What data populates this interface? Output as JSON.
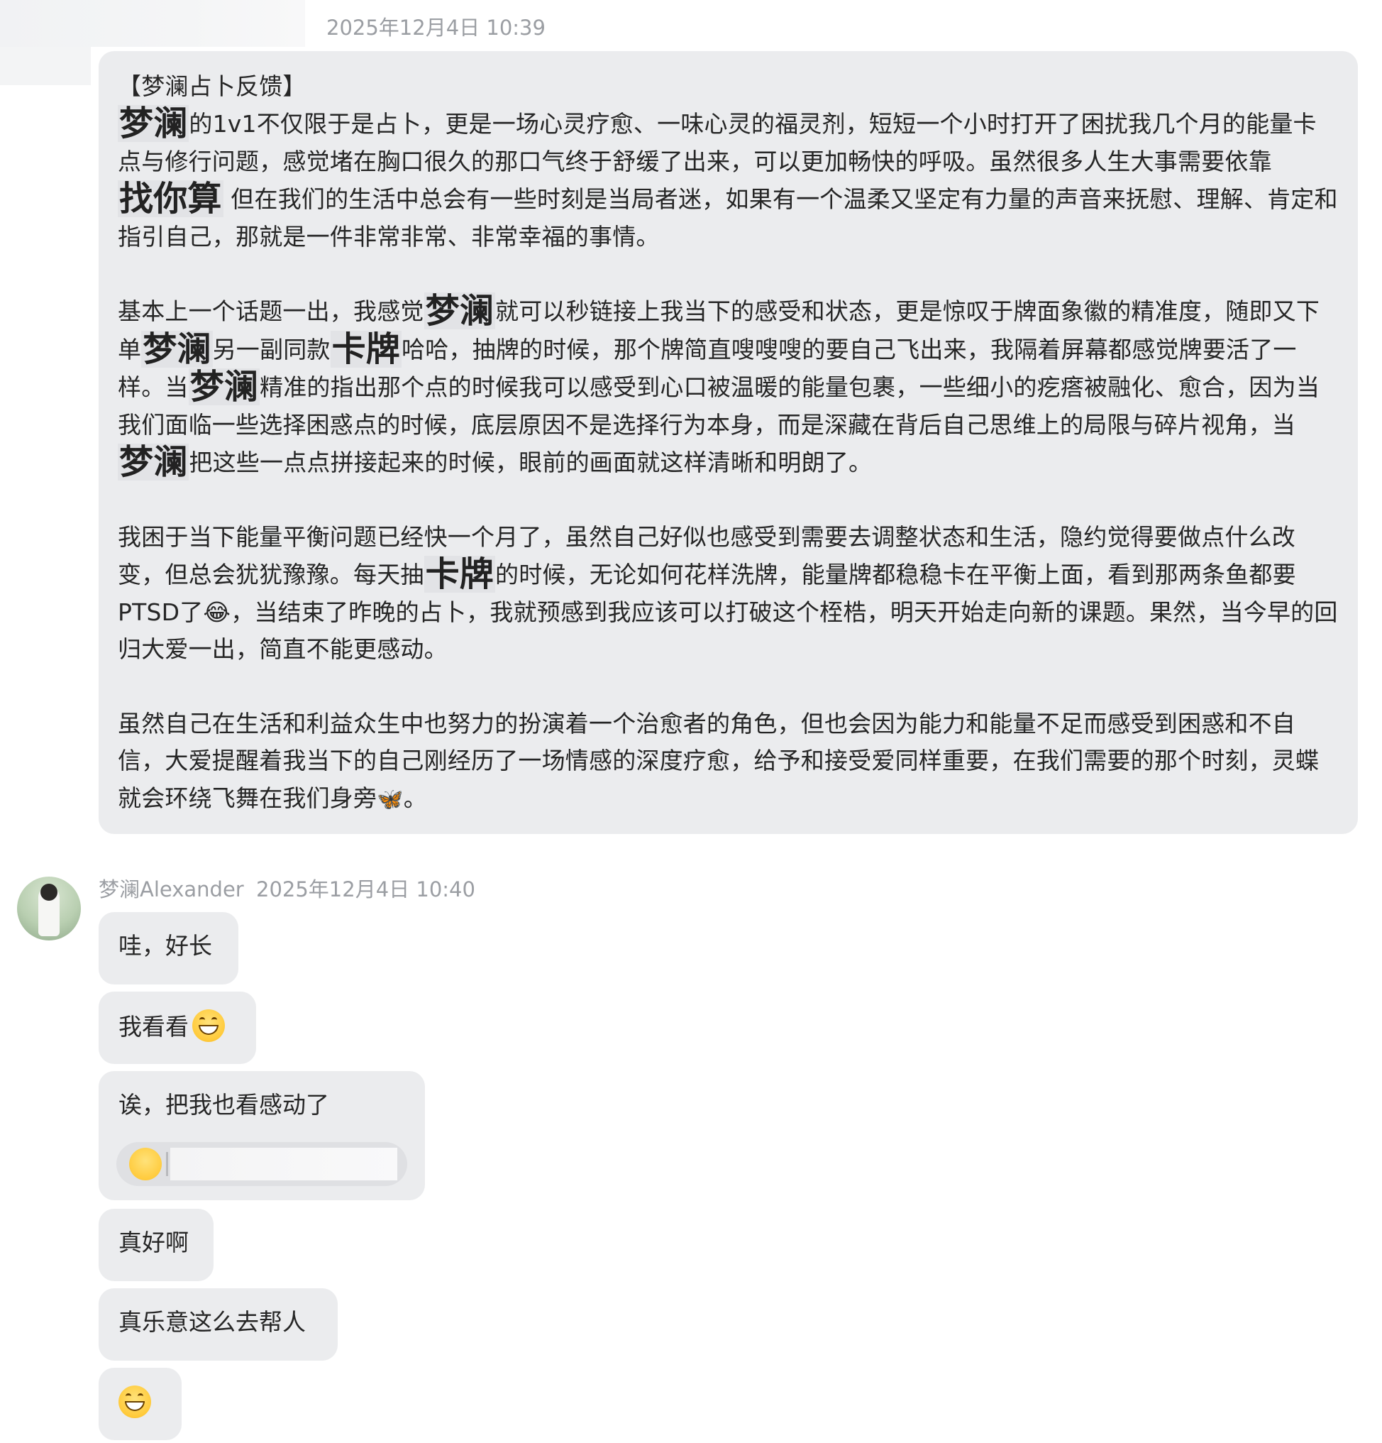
{
  "header": {
    "timestamp": "2025年12月4日 10:39"
  },
  "long_message": {
    "paragraphs": [
      {
        "segments": [
          {
            "t": "【梦澜占卜反馈】",
            "br": true
          },
          {
            "t": "梦澜",
            "ovl": true
          },
          {
            "t": "的1v1不仅限于是占卜，更是一场心灵疗愈、一味心灵的福灵剂，短短一个小时打开了困扰我几个月的能量卡点与修行问题，感觉堵在胸口很久的那口气终于舒缓了出来，可以更加畅快的呼吸。虽然很多人生大事需要依靠"
          },
          {
            "t": "找你算",
            "ovl": true
          },
          {
            "t": " 但在我们的生活中总会有一些时刻是当局者迷，如果有一个温柔又坚定有力量的声音来抚慰、理解、肯定和指引自己，那就是一件非常非常、非常幸福的事情。"
          }
        ]
      },
      {
        "segments": [
          {
            "t": "基本上一个话题一出，我感觉"
          },
          {
            "t": "梦澜",
            "ovl": true
          },
          {
            "t": "就可以秒链接上我当下的感受和状态，更是惊叹于牌面象徽的精准度，随即又下单"
          },
          {
            "t": "梦澜",
            "ovl": true
          },
          {
            "t": "另一副同款"
          },
          {
            "t": "卡牌",
            "ovl": true
          },
          {
            "t": "哈哈，抽牌的时候，那个牌简直嗖嗖嗖的要自己飞出来，我隔着屏幕都感觉牌要活了一样。当"
          },
          {
            "t": "梦澜",
            "ovl": true
          },
          {
            "t": "精准的指出那个点的时候我可以感受到心口被温暖的能量包裹，一些细小的疙瘩被融化、愈合，因为当我们面临一些选择困惑点的时候，底层原因不是选择行为本身，而是深藏在背后自己思维上的局限与碎片视角，当"
          },
          {
            "t": "梦澜",
            "ovl": true
          },
          {
            "t": "把这些一点点拼接起来的时候，眼前的画面就这样清晰和明朗了。"
          }
        ]
      },
      {
        "segments": [
          {
            "t": "我困于当下能量平衡问题已经快一个月了，虽然自己好似也感受到需要去调整状态和生活，隐约觉得要做点什么改变，但总会犹犹豫豫。每天抽"
          },
          {
            "t": "卡牌",
            "ovl": true
          },
          {
            "t": "的时候，无论如何花样洗牌，能量牌都稳稳卡在平衡上面，看到那两条鱼都要PTSD了"
          },
          {
            "t": "😂",
            "emoji": true
          },
          {
            "t": "，当结束了昨晚的占卜，我就预感到我应该可以打破这个桎梏，明天开始走向新的课题。果然，当今早的回归大爱一出，简直不能更感动。"
          }
        ]
      },
      {
        "segments": [
          {
            "t": "虽然自己在生活和利益众生中也努力的扮演着一个治愈者的角色，但也会因为能力和能量不足而感受到困惑和不自信，大爱提醒着我当下的自己刚经历了一场情感的深度疗愈，给予和接受爱同样重要，在我们需要的那个时刻，灵蝶就会环绕飞舞在我们身旁"
          },
          {
            "t": "🦋",
            "butterfly": true
          },
          {
            "t": "。"
          }
        ]
      }
    ]
  },
  "reply": {
    "sender": "梦澜Alexander",
    "timestamp": "2025年12月4日 10:40",
    "messages": [
      {
        "text": "哇，好长"
      },
      {
        "text": "我看看",
        "emoji": "grin-emoji"
      },
      {
        "text": "诶，把我也看感动了",
        "quote": "hug-emoji"
      },
      {
        "text": "真好啊"
      },
      {
        "text": "真乐意这么去帮人"
      },
      {
        "text": "",
        "emoji": "grin-emoji"
      }
    ]
  },
  "colors": {
    "bubble_bg": "#ebecee",
    "meta_text": "#9b9ea3",
    "body_text": "#262626"
  }
}
